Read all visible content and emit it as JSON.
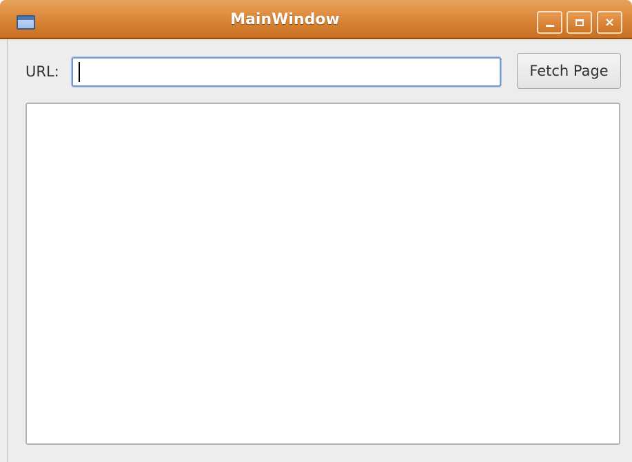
{
  "window": {
    "title": "MainWindow",
    "title_icon": "app-window-icon",
    "controls": {
      "minimize_icon": "minimize-icon",
      "maximize_icon": "maximize-icon",
      "close_icon": "close-icon",
      "close_glyph": "×"
    }
  },
  "form": {
    "url_label": "URL:",
    "url_value": "",
    "fetch_button_label": "Fetch Page"
  },
  "output": {
    "content": ""
  },
  "colors": {
    "titlebar": "#dc8a3b",
    "focus_border": "#6f9ad3",
    "window_bg": "#ededed"
  }
}
